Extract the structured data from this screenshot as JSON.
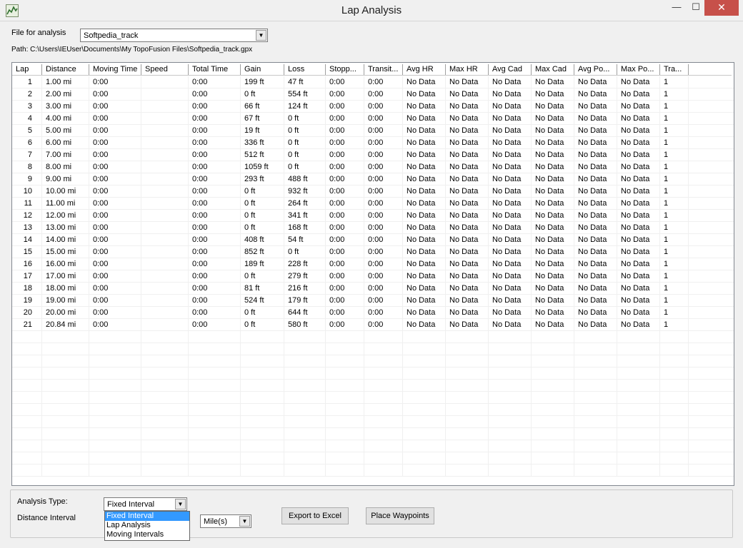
{
  "window": {
    "title": "Lap Analysis",
    "minimize": "—",
    "maximize": "☐",
    "close": "✕"
  },
  "file": {
    "label": "File for analysis",
    "selected": "Softpedia_track",
    "path": "Path: C:\\Users\\IEUser\\Documents\\My TopoFusion Files\\Softpedia_track.gpx"
  },
  "table": {
    "columns": [
      "Lap",
      "Distance",
      "Moving Time",
      "Speed",
      "Total Time",
      "Gain",
      "Loss",
      "Stopp...",
      "Transit...",
      "Avg HR",
      "Max HR",
      "Avg Cad",
      "Max Cad",
      "Avg Po...",
      "Max Po...",
      "Tra..."
    ],
    "rows": [
      [
        "1",
        "1.00 mi",
        "0:00",
        "",
        "0:00",
        "199 ft",
        "47 ft",
        "0:00",
        "0:00",
        "No Data",
        "No Data",
        "No Data",
        "No Data",
        "No Data",
        "No Data",
        "1"
      ],
      [
        "2",
        "2.00 mi",
        "0:00",
        "",
        "0:00",
        "0 ft",
        "554 ft",
        "0:00",
        "0:00",
        "No Data",
        "No Data",
        "No Data",
        "No Data",
        "No Data",
        "No Data",
        "1"
      ],
      [
        "3",
        "3.00 mi",
        "0:00",
        "",
        "0:00",
        "66 ft",
        "124 ft",
        "0:00",
        "0:00",
        "No Data",
        "No Data",
        "No Data",
        "No Data",
        "No Data",
        "No Data",
        "1"
      ],
      [
        "4",
        "4.00 mi",
        "0:00",
        "",
        "0:00",
        "67 ft",
        "0 ft",
        "0:00",
        "0:00",
        "No Data",
        "No Data",
        "No Data",
        "No Data",
        "No Data",
        "No Data",
        "1"
      ],
      [
        "5",
        "5.00 mi",
        "0:00",
        "",
        "0:00",
        "19 ft",
        "0 ft",
        "0:00",
        "0:00",
        "No Data",
        "No Data",
        "No Data",
        "No Data",
        "No Data",
        "No Data",
        "1"
      ],
      [
        "6",
        "6.00 mi",
        "0:00",
        "",
        "0:00",
        "336 ft",
        "0 ft",
        "0:00",
        "0:00",
        "No Data",
        "No Data",
        "No Data",
        "No Data",
        "No Data",
        "No Data",
        "1"
      ],
      [
        "7",
        "7.00 mi",
        "0:00",
        "",
        "0:00",
        "512 ft",
        "0 ft",
        "0:00",
        "0:00",
        "No Data",
        "No Data",
        "No Data",
        "No Data",
        "No Data",
        "No Data",
        "1"
      ],
      [
        "8",
        "8.00 mi",
        "0:00",
        "",
        "0:00",
        "1059 ft",
        "0 ft",
        "0:00",
        "0:00",
        "No Data",
        "No Data",
        "No Data",
        "No Data",
        "No Data",
        "No Data",
        "1"
      ],
      [
        "9",
        "9.00 mi",
        "0:00",
        "",
        "0:00",
        "293 ft",
        "488 ft",
        "0:00",
        "0:00",
        "No Data",
        "No Data",
        "No Data",
        "No Data",
        "No Data",
        "No Data",
        "1"
      ],
      [
        "10",
        "10.00 mi",
        "0:00",
        "",
        "0:00",
        "0 ft",
        "932 ft",
        "0:00",
        "0:00",
        "No Data",
        "No Data",
        "No Data",
        "No Data",
        "No Data",
        "No Data",
        "1"
      ],
      [
        "11",
        "11.00 mi",
        "0:00",
        "",
        "0:00",
        "0 ft",
        "264 ft",
        "0:00",
        "0:00",
        "No Data",
        "No Data",
        "No Data",
        "No Data",
        "No Data",
        "No Data",
        "1"
      ],
      [
        "12",
        "12.00 mi",
        "0:00",
        "",
        "0:00",
        "0 ft",
        "341 ft",
        "0:00",
        "0:00",
        "No Data",
        "No Data",
        "No Data",
        "No Data",
        "No Data",
        "No Data",
        "1"
      ],
      [
        "13",
        "13.00 mi",
        "0:00",
        "",
        "0:00",
        "0 ft",
        "168 ft",
        "0:00",
        "0:00",
        "No Data",
        "No Data",
        "No Data",
        "No Data",
        "No Data",
        "No Data",
        "1"
      ],
      [
        "14",
        "14.00 mi",
        "0:00",
        "",
        "0:00",
        "408 ft",
        "54 ft",
        "0:00",
        "0:00",
        "No Data",
        "No Data",
        "No Data",
        "No Data",
        "No Data",
        "No Data",
        "1"
      ],
      [
        "15",
        "15.00 mi",
        "0:00",
        "",
        "0:00",
        "852 ft",
        "0 ft",
        "0:00",
        "0:00",
        "No Data",
        "No Data",
        "No Data",
        "No Data",
        "No Data",
        "No Data",
        "1"
      ],
      [
        "16",
        "16.00 mi",
        "0:00",
        "",
        "0:00",
        "189 ft",
        "228 ft",
        "0:00",
        "0:00",
        "No Data",
        "No Data",
        "No Data",
        "No Data",
        "No Data",
        "No Data",
        "1"
      ],
      [
        "17",
        "17.00 mi",
        "0:00",
        "",
        "0:00",
        "0 ft",
        "279 ft",
        "0:00",
        "0:00",
        "No Data",
        "No Data",
        "No Data",
        "No Data",
        "No Data",
        "No Data",
        "1"
      ],
      [
        "18",
        "18.00 mi",
        "0:00",
        "",
        "0:00",
        "81 ft",
        "216 ft",
        "0:00",
        "0:00",
        "No Data",
        "No Data",
        "No Data",
        "No Data",
        "No Data",
        "No Data",
        "1"
      ],
      [
        "19",
        "19.00 mi",
        "0:00",
        "",
        "0:00",
        "524 ft",
        "179 ft",
        "0:00",
        "0:00",
        "No Data",
        "No Data",
        "No Data",
        "No Data",
        "No Data",
        "No Data",
        "1"
      ],
      [
        "20",
        "20.00 mi",
        "0:00",
        "",
        "0:00",
        "0 ft",
        "644 ft",
        "0:00",
        "0:00",
        "No Data",
        "No Data",
        "No Data",
        "No Data",
        "No Data",
        "No Data",
        "1"
      ],
      [
        "21",
        "20.84 mi",
        "0:00",
        "",
        "0:00",
        "0 ft",
        "580 ft",
        "0:00",
        "0:00",
        "No Data",
        "No Data",
        "No Data",
        "No Data",
        "No Data",
        "No Data",
        "1"
      ]
    ]
  },
  "analysis": {
    "type_label": "Analysis Type:",
    "type_selected": "Fixed Interval",
    "type_options": [
      "Fixed Interval",
      "Lap Analysis",
      "Moving Intervals"
    ],
    "distance_label": "Distance Interval",
    "unit_selected": "Mile(s)",
    "export_button": "Export to Excel",
    "waypoints_button": "Place Waypoints"
  }
}
